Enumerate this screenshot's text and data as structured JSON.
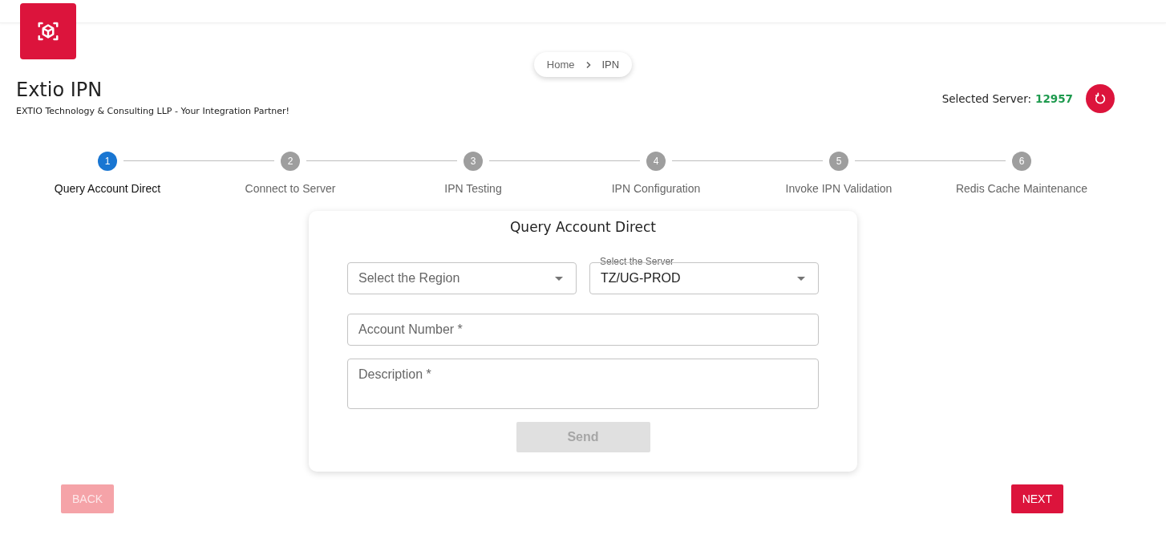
{
  "header": {
    "title": "Extio IPN",
    "subtitle": "EXTIO Technology & Consulting LLP - Your Integration Partner!",
    "server_label": "Selected Server:",
    "server_value": "12957"
  },
  "breadcrumb": [
    {
      "label": "Home",
      "selected": false
    },
    {
      "label": "IPN",
      "selected": true
    }
  ],
  "steps": [
    {
      "number": "1",
      "label": "Query Account Direct",
      "selected": true
    },
    {
      "number": "2",
      "label": "Connect to Server",
      "selected": false
    },
    {
      "number": "3",
      "label": "IPN Testing",
      "selected": false
    },
    {
      "number": "4",
      "label": "IPN Configuration",
      "selected": false
    },
    {
      "number": "5",
      "label": "Invoke IPN Validation",
      "selected": false
    },
    {
      "number": "6",
      "label": "Redis Cache Maintenance",
      "selected": false
    }
  ],
  "form": {
    "title": "Query Account Direct",
    "region": {
      "placeholder": "Select the Region"
    },
    "server": {
      "label": "Select the Server",
      "value": "TZ/UG-PROD"
    },
    "account": {
      "placeholder": "Account Number *"
    },
    "description": {
      "placeholder": "Description *"
    },
    "send": {
      "label": "Send",
      "disabled": true
    }
  },
  "nav": {
    "back": {
      "label": "BACK",
      "disabled": true
    },
    "next": {
      "label": "NEXT",
      "disabled": false
    }
  }
}
